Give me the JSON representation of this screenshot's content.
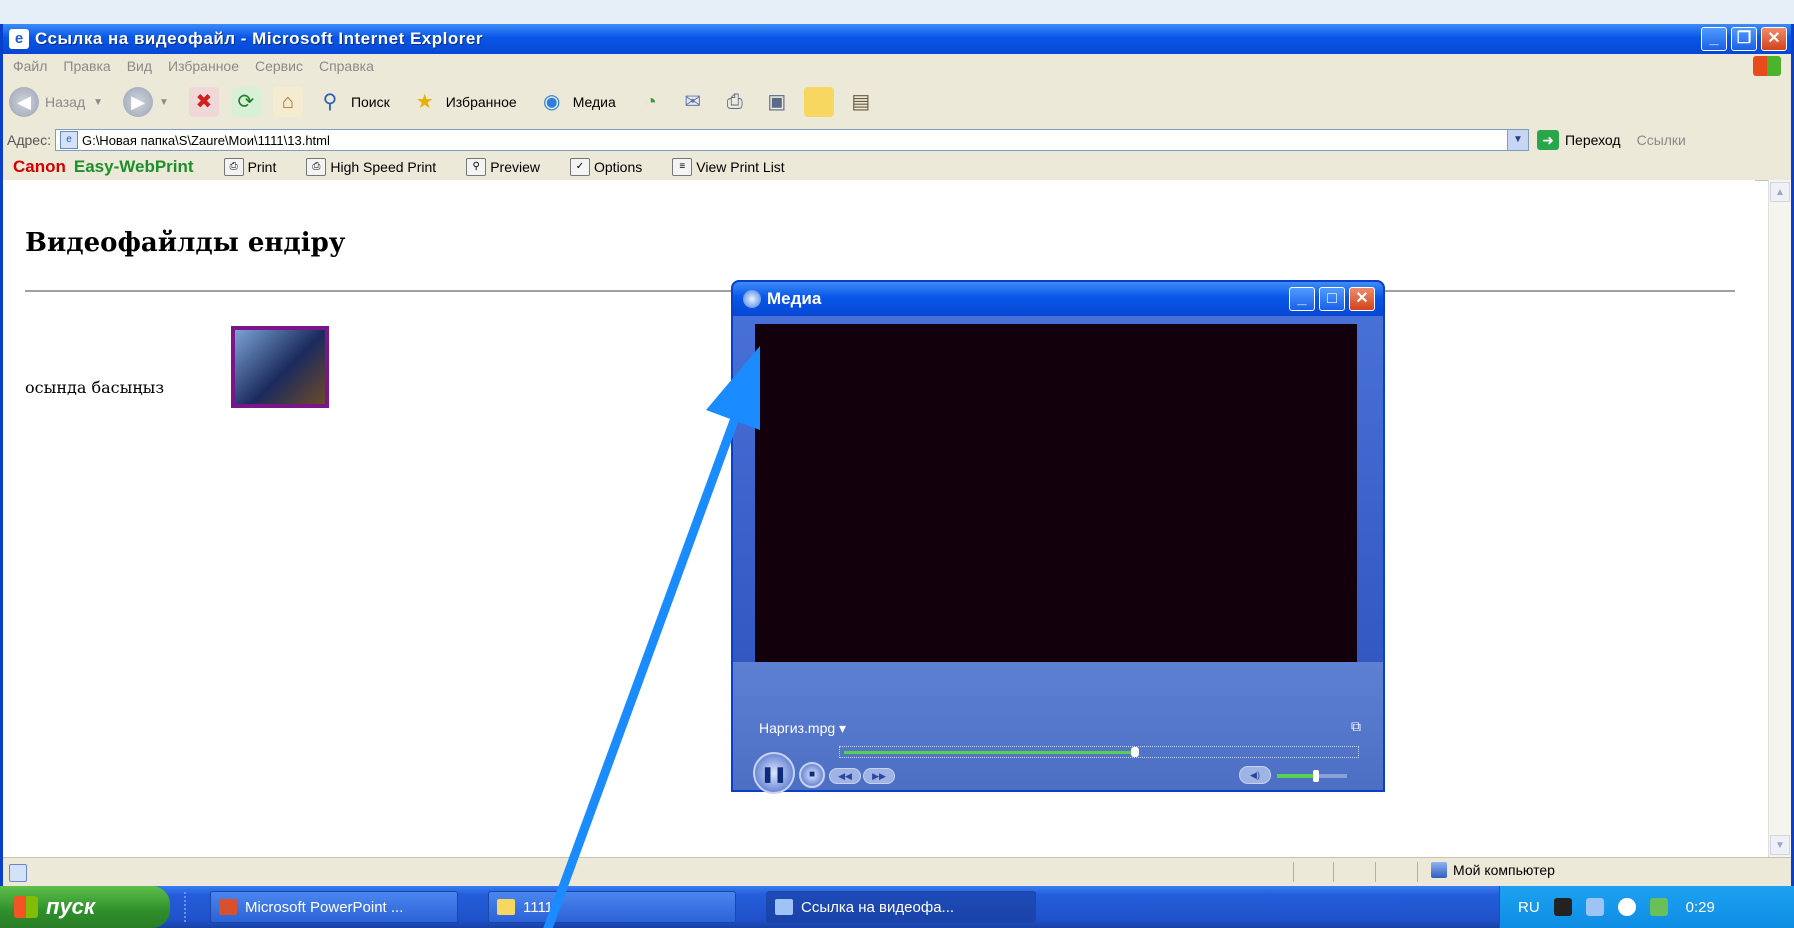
{
  "window": {
    "title": "Ссылка на видеофайл - Microsoft Internet Explorer"
  },
  "menu": [
    "Файл",
    "Правка",
    "Вид",
    "Избранное",
    "Сервис",
    "Справка"
  ],
  "toolbar": {
    "back": "Назад",
    "search": "Поиск",
    "favorites": "Избранное",
    "media": "Медиа"
  },
  "address": {
    "label": "Адрес:",
    "value": "G:\\Новая папка\\S\\Zaure\\Мои\\1111\\13.html",
    "go": "Переход",
    "links": "Ссылки"
  },
  "canon": {
    "brand": "Canon",
    "product": "Easy-WebPrint",
    "print": "Print",
    "high_speed": "High Speed Print",
    "preview": "Preview",
    "options": "Options",
    "view_list": "View Print List"
  },
  "page": {
    "heading": "Видеофайлды ендіру",
    "text": "осында басыңыз"
  },
  "media_player": {
    "title": "Медиа",
    "clip": "Наргиз.mpg",
    "seek_progress": 0.57,
    "volume": 0.55
  },
  "status": {
    "zone": "Мой компьютер"
  },
  "taskbar": {
    "start": "пуск",
    "items": [
      "Microsoft PowerPoint ...",
      "1111",
      "Ссылка на видеофа..."
    ],
    "lang": "RU",
    "clock": "0:29"
  },
  "colors": {
    "xp_blue": "#0856e8",
    "start_green": "#2e8f2b",
    "annotation_arrow": "#1a8cff"
  }
}
